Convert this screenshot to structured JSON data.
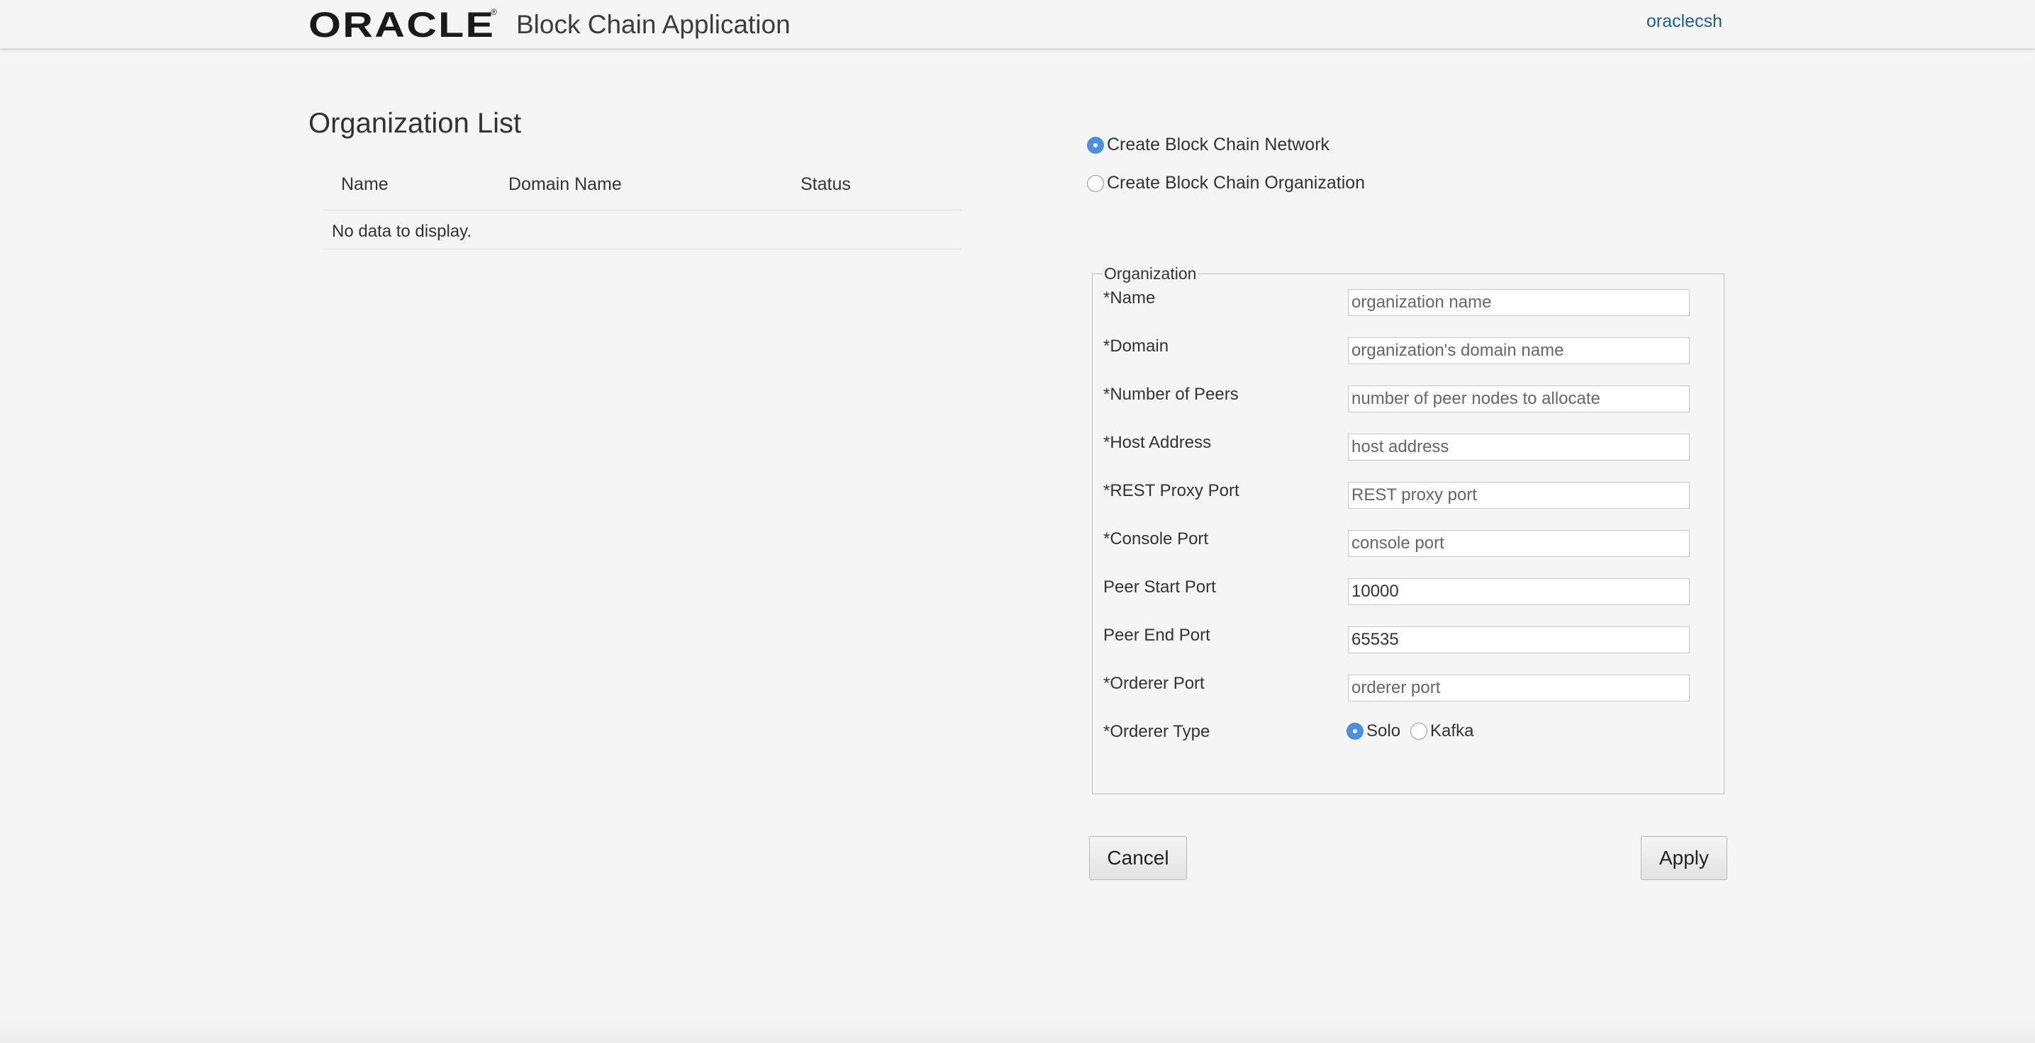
{
  "header": {
    "logo": "ORACLE",
    "app_title": "Block Chain Application",
    "user": "oraclecsh"
  },
  "org_list": {
    "title": "Organization List",
    "columns": [
      "Name",
      "Domain Name",
      "Status"
    ],
    "empty_text": "No data to display."
  },
  "mode": {
    "options": [
      {
        "label": "Create Block Chain Network",
        "checked": true
      },
      {
        "label": "Create Block Chain Organization",
        "checked": false
      }
    ]
  },
  "form": {
    "legend": "Organization",
    "fields": [
      {
        "label": "*Name",
        "placeholder": "organization name",
        "value": ""
      },
      {
        "label": "*Domain",
        "placeholder": "organization's domain name",
        "value": ""
      },
      {
        "label": "*Number of Peers",
        "placeholder": "number of peer nodes to allocate",
        "value": ""
      },
      {
        "label": "*Host Address",
        "placeholder": "host address",
        "value": ""
      },
      {
        "label": "*REST Proxy Port",
        "placeholder": "REST proxy port",
        "value": ""
      },
      {
        "label": "*Console Port",
        "placeholder": "console port",
        "value": ""
      },
      {
        "label": "Peer Start Port",
        "placeholder": "",
        "value": "10000"
      },
      {
        "label": "Peer End Port",
        "placeholder": "",
        "value": "65535"
      },
      {
        "label": "*Orderer Port",
        "placeholder": "orderer port",
        "value": ""
      }
    ],
    "orderer_type": {
      "label": "*Orderer Type",
      "options": [
        {
          "label": "Solo",
          "checked": true
        },
        {
          "label": "Kafka",
          "checked": false
        }
      ]
    }
  },
  "buttons": {
    "cancel": "Cancel",
    "apply": "Apply"
  },
  "colors": {
    "accent": "#4a90e2",
    "link": "#1d5d9e",
    "background": "#f5f5f5"
  }
}
